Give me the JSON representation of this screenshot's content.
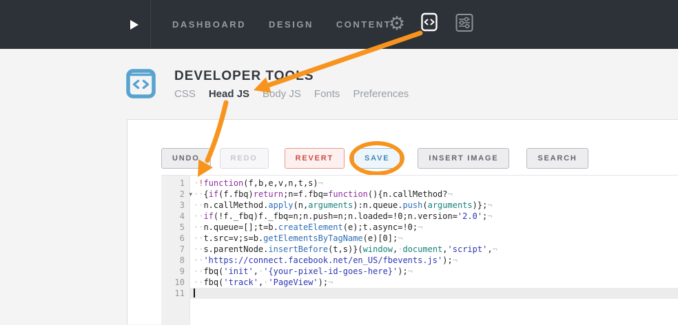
{
  "topbar": {
    "nav_items": [
      "DASHBOARD",
      "DESIGN",
      "CONTENT"
    ],
    "gear_glyph": "⚙",
    "active_icon": "code-icon",
    "bg_color": "#2d3138",
    "text_color": "#979ba1"
  },
  "header": {
    "title": "DEVELOPER TOOLS",
    "icon": "code-window-icon",
    "icon_color": "#57a3cf",
    "tabs": [
      {
        "label": "CSS",
        "active": false
      },
      {
        "label": "Head JS",
        "active": true
      },
      {
        "label": "Body JS",
        "active": false
      },
      {
        "label": "Fonts",
        "active": false
      },
      {
        "label": "Preferences",
        "active": false
      }
    ]
  },
  "toolbar": {
    "buttons": [
      {
        "label": "UNDO",
        "style": "default",
        "name": "undo-button"
      },
      {
        "label": "REDO",
        "style": "disabled",
        "name": "redo-button"
      },
      {
        "label": "REVERT",
        "style": "danger",
        "name": "revert-button"
      },
      {
        "label": "SAVE",
        "style": "primary",
        "name": "save-button",
        "annotated": true
      },
      {
        "label": "INSERT IMAGE",
        "style": "default",
        "name": "insert-image-button"
      },
      {
        "label": "SEARCH",
        "style": "default",
        "name": "search-button"
      }
    ]
  },
  "editor": {
    "active_line": 11,
    "fold_glyph": "▾",
    "lines": [
      {
        "num": 1,
        "fold": false,
        "segments": [
          [
            "ws",
            "·"
          ],
          [
            "err",
            "!"
          ],
          [
            "kw",
            "function"
          ],
          [
            "pl",
            "(f,b,e,v,n,t,s)"
          ],
          [
            "eol",
            "¬"
          ]
        ]
      },
      {
        "num": 2,
        "fold": true,
        "segments": [
          [
            "ws",
            "··"
          ],
          [
            "pl",
            "{"
          ],
          [
            "kw",
            "if"
          ],
          [
            "pl",
            "(f.fbq)"
          ],
          [
            "kw",
            "return"
          ],
          [
            "pl",
            ";n=f.fbq="
          ],
          [
            "kw",
            "function"
          ],
          [
            "pl",
            "(){n.callMethod?"
          ],
          [
            "eol",
            "¬"
          ]
        ]
      },
      {
        "num": 3,
        "fold": false,
        "segments": [
          [
            "ws",
            "··"
          ],
          [
            "pl",
            "n.callMethod."
          ],
          [
            "fn",
            "apply"
          ],
          [
            "pl",
            "(n,"
          ],
          [
            "lang",
            "arguments"
          ],
          [
            "pl",
            "):n.queue."
          ],
          [
            "fn",
            "push"
          ],
          [
            "pl",
            "("
          ],
          [
            "lang",
            "arguments"
          ],
          [
            "pl",
            ")};"
          ],
          [
            "eol",
            "¬"
          ]
        ]
      },
      {
        "num": 4,
        "fold": false,
        "segments": [
          [
            "ws",
            "··"
          ],
          [
            "kw",
            "if"
          ],
          [
            "pl",
            "(!f._fbq)f._fbq=n;n.push=n;n.loaded=!0;n.version="
          ],
          [
            "str",
            "'2.0'"
          ],
          [
            "pl",
            ";"
          ],
          [
            "eol",
            "¬"
          ]
        ]
      },
      {
        "num": 5,
        "fold": false,
        "segments": [
          [
            "ws",
            "··"
          ],
          [
            "pl",
            "n.queue=[];t=b."
          ],
          [
            "fn",
            "createElement"
          ],
          [
            "pl",
            "(e);t.async=!0;"
          ],
          [
            "eol",
            "¬"
          ]
        ]
      },
      {
        "num": 6,
        "fold": false,
        "segments": [
          [
            "ws",
            "··"
          ],
          [
            "pl",
            "t.src=v;s=b."
          ],
          [
            "fn",
            "getElementsByTagName"
          ],
          [
            "pl",
            "(e)[0];"
          ],
          [
            "eol",
            "¬"
          ]
        ]
      },
      {
        "num": 7,
        "fold": false,
        "segments": [
          [
            "ws",
            "··"
          ],
          [
            "pl",
            "s.parentNode."
          ],
          [
            "fn",
            "insertBefore"
          ],
          [
            "pl",
            "(t,s)}("
          ],
          [
            "lang",
            "window"
          ],
          [
            "pl",
            ","
          ],
          [
            "ws",
            "·"
          ],
          [
            "lang",
            "document"
          ],
          [
            "pl",
            ","
          ],
          [
            "str",
            "'script'"
          ],
          [
            "pl",
            ","
          ],
          [
            "eol",
            "¬"
          ]
        ]
      },
      {
        "num": 8,
        "fold": false,
        "segments": [
          [
            "ws",
            "··"
          ],
          [
            "str",
            "'https://connect.facebook.net/en_US/fbevents.js'"
          ],
          [
            "pl",
            ");"
          ],
          [
            "eol",
            "¬"
          ]
        ]
      },
      {
        "num": 9,
        "fold": false,
        "segments": [
          [
            "ws",
            "··"
          ],
          [
            "pl",
            "fbq("
          ],
          [
            "str",
            "'init'"
          ],
          [
            "pl",
            ","
          ],
          [
            "ws",
            "·"
          ],
          [
            "str",
            "'{your-pixel-id-goes-here}'"
          ],
          [
            "pl",
            ");"
          ],
          [
            "eol",
            "¬"
          ]
        ]
      },
      {
        "num": 10,
        "fold": false,
        "segments": [
          [
            "ws",
            "··"
          ],
          [
            "pl",
            "fbq("
          ],
          [
            "str",
            "'track'"
          ],
          [
            "pl",
            ","
          ],
          [
            "ws",
            "·"
          ],
          [
            "str",
            "'PageView'"
          ],
          [
            "pl",
            ");"
          ],
          [
            "eol",
            "¬"
          ]
        ]
      },
      {
        "num": 11,
        "fold": false,
        "segments": []
      }
    ],
    "syntax_colors": {
      "keyword": "#8e2f9e",
      "string": "#2c36b1",
      "builtin_function": "#2e6db4",
      "language_variable": "#168079",
      "error": "#d94a35",
      "plain": "#1f1f1f",
      "whitespace": "#b9bec4"
    }
  },
  "annotations": {
    "color": "#f7941e",
    "items": [
      "arrow-from-head-js-tab-to-code-icon",
      "arrow-from-head-js-tab-to-editor",
      "ellipse-around-save-button"
    ]
  }
}
